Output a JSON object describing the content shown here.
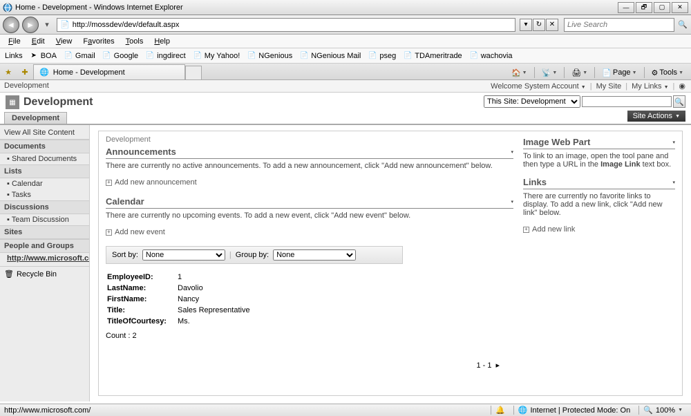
{
  "window": {
    "title": "Home - Development - Windows Internet Explorer"
  },
  "nav": {
    "url": "http://mossdev/dev/default.aspx",
    "search_placeholder": "Live Search"
  },
  "menubar": {
    "file": "File",
    "edit": "Edit",
    "view": "View",
    "favorites": "Favorites",
    "tools": "Tools",
    "help": "Help"
  },
  "linksbar": {
    "label": "Links",
    "items": [
      "BOA",
      "Gmail",
      "Google",
      "ingdirect",
      "My Yahoo!",
      "NGenious",
      "NGenious Mail",
      "pseg",
      "TDAmeritrade",
      "wachovia"
    ]
  },
  "tab": {
    "label": "Home - Development"
  },
  "cmdbar": {
    "page": "Page",
    "tools": "Tools"
  },
  "sp": {
    "crumb": "Development",
    "welcome": "Welcome System Account",
    "mysite": "My Site",
    "mylinks": "My Links",
    "title": "Development",
    "scope": "This Site: Development",
    "siteactions": "Site Actions",
    "tab": "Development"
  },
  "left": {
    "viewall": "View All Site Content",
    "documents": "Documents",
    "shared": "Shared Documents",
    "lists": "Lists",
    "calendar": "Calendar",
    "tasks": "Tasks",
    "discussions": "Discussions",
    "team": "Team Discussion",
    "sites": "Sites",
    "people": "People and Groups",
    "ext": "http://www.microsoft.com",
    "recycle": "Recycle Bin"
  },
  "center": {
    "crumb": "Development",
    "ann_title": "Announcements",
    "ann_body": "There are currently no active announcements. To add a new announcement, click \"Add new announcement\" below.",
    "ann_add": "Add new announcement",
    "cal_title": "Calendar",
    "cal_body": "There are currently no upcoming events. To add a new event, click \"Add new event\" below.",
    "cal_add": "Add new event",
    "sort_label": "Sort by:",
    "sort_val": "None",
    "group_label": "Group by:",
    "group_val": "None",
    "emp": {
      "EmployeeID": "1",
      "LastName": "Davolio",
      "FirstName": "Nancy",
      "Title": "Sales Representative",
      "TitleOfCourtesy": "Ms."
    },
    "count": "Count : 2",
    "pager": "1 - 1"
  },
  "right": {
    "img_title": "Image Web Part",
    "img_body_pre": "To link to an image, open the tool pane and then type a URL in the ",
    "img_body_bold": "Image Link",
    "img_body_post": " text box.",
    "links_title": "Links",
    "links_body": "There are currently no favorite links to display. To add a new link, click \"Add new link\" below.",
    "links_add": "Add new link"
  },
  "status": {
    "left": "http://www.microsoft.com/",
    "zone": "Internet | Protected Mode: On",
    "zoom": "100%"
  }
}
